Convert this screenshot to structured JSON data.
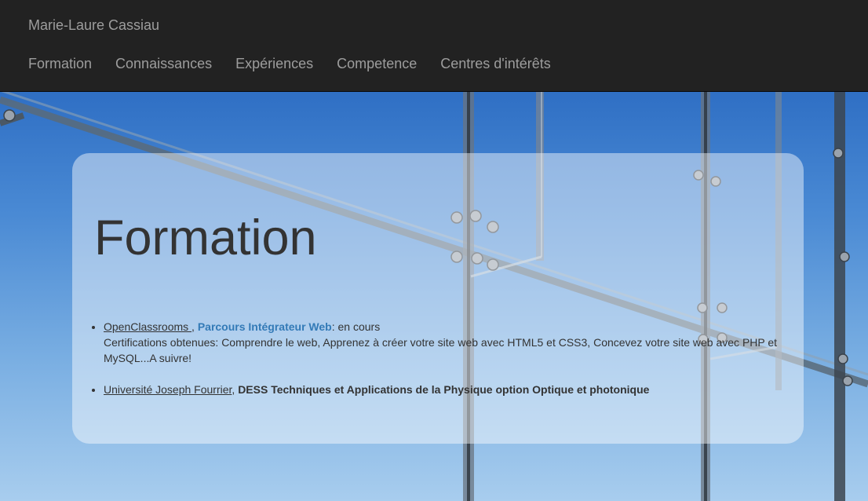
{
  "header": {
    "brand": "Marie-Laure Cassiau",
    "nav": [
      "Formation",
      "Connaissances",
      "Expériences",
      "Competence",
      "Centres d'intérêts"
    ]
  },
  "main": {
    "title": "Formation",
    "items": [
      {
        "school": "OpenClassrooms ",
        "sep": ", ",
        "program": "Parcours Intégrateur Web",
        "status": ": en cours",
        "details": "Certifications obtenues: Comprendre le web, Apprenez à créer votre site web avec HTML5 et CSS3, Concevez votre site web avec PHP et MySQL...A suivre!"
      },
      {
        "school": "Université Joseph Fourrier",
        "sep": ", ",
        "program": "DESS Techniques et Applications de la Physique option Optique et photonique"
      }
    ]
  },
  "colors": {
    "navbar": "#222222",
    "nav_text": "#9d9d9d",
    "link_blue": "#337ab7",
    "text": "#333333"
  }
}
